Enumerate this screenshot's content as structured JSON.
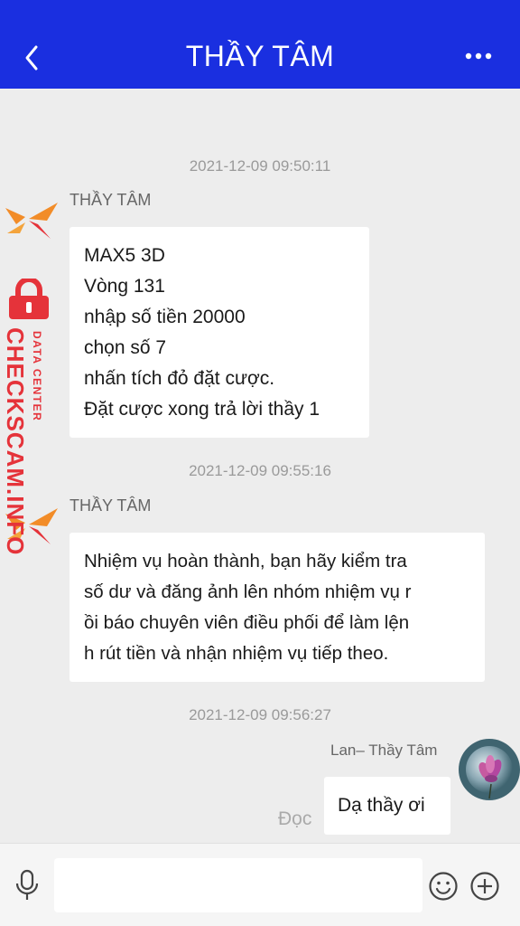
{
  "header": {
    "title": "THẦY TÂM",
    "back_icon": "chevron-left-icon",
    "more_icon": "more-horizontal-icon",
    "background": "#1a2fe0"
  },
  "messages": [
    {
      "timestamp": "2021-12-09 09:50:11",
      "sender": "THẦY TÂM",
      "lines": [
        "MAX5 3D",
        "Vòng 131",
        "nhập số tiền 20000",
        "chọn số 7",
        "nhấn tích đỏ đặt cược.",
        "Đặt cược xong trả lời thầy 1"
      ]
    },
    {
      "timestamp": "2021-12-09 09:55:16",
      "sender": "THẦY TÂM",
      "lines": [
        "Nhiệm vụ hoàn thành, bạn hãy kiểm tra",
        "số dư và đăng ảnh lên nhóm nhiệm vụ r",
        "ồi báo chuyên viên điều phối để làm lện",
        "h rút tiền và nhận nhiệm vụ tiếp theo."
      ]
    },
    {
      "timestamp": "2021-12-09 09:56:27",
      "sender": "Lan– Thầy Tâm",
      "text": "Dạ thầy ơi",
      "status": "Đọc"
    }
  ],
  "watermark": {
    "brand": "CHECKSCAM.INFO",
    "tagline": "DATA CENTER",
    "color": "#e5333a"
  },
  "composer": {
    "placeholder": "",
    "mic_icon": "microphone-icon",
    "emoji_icon": "smiley-icon",
    "plus_icon": "plus-circle-icon"
  }
}
